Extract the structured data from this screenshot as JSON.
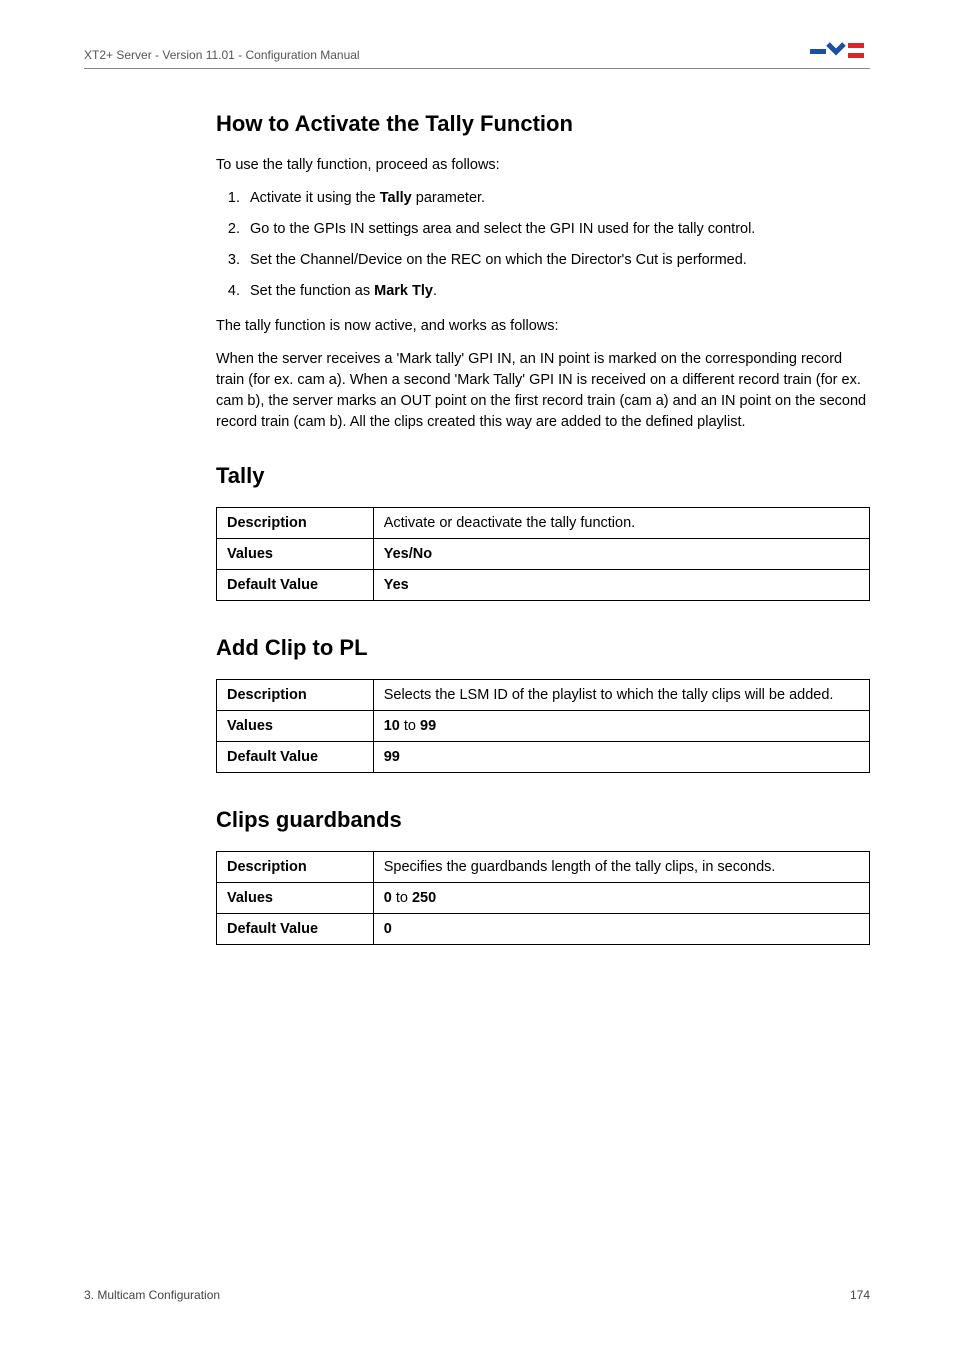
{
  "header": {
    "doc_title": "XT2+ Server - Version 11.01 - Configuration Manual"
  },
  "sections": {
    "activate": {
      "title": "How to Activate the Tally Function",
      "intro": "To use the tally function, proceed as follows:",
      "step1_pre": "Activate it using the ",
      "step1_bold": "Tally",
      "step1_post": " parameter.",
      "step2": "Go to the GPIs IN settings area and select the GPI IN used for the tally control.",
      "step3": "Set the Channel/Device on the REC on which the Director's Cut is performed.",
      "step4_pre": "Set the function as ",
      "step4_bold": "Mark Tly",
      "step4_post": ".",
      "after_steps": "The tally function is now active, and works as follows:",
      "explain": "When the server receives a 'Mark tally' GPI IN, an IN point is marked on the corresponding record train (for ex. cam a). When a second 'Mark Tally' GPI IN is received on a different record train (for ex. cam b), the server marks an OUT point on the first record train (cam a) and an IN point on the second record train (cam b). All the clips created this way are added to the defined playlist."
    },
    "tally": {
      "title": "Tally",
      "desc_label": "Description",
      "desc_value": "Activate or deactivate the tally function.",
      "values_label": "Values",
      "values_value": "Yes/No",
      "default_label": "Default Value",
      "default_value": "Yes"
    },
    "addclip": {
      "title": "Add Clip to PL",
      "desc_label": "Description",
      "desc_value": "Selects the LSM ID of the playlist to which the tally clips will be added.",
      "values_label": "Values",
      "values_value_a": "10",
      "values_value_mid": " to ",
      "values_value_b": "99",
      "default_label": "Default Value",
      "default_value": "99"
    },
    "guardbands": {
      "title": "Clips guardbands",
      "desc_label": "Description",
      "desc_value": "Specifies the guardbands length of the tally clips, in seconds.",
      "values_label": "Values",
      "values_value_a": "0",
      "values_value_mid": " to ",
      "values_value_b": "250",
      "default_label": "Default Value",
      "default_value": "0"
    }
  },
  "footer": {
    "left": "3. Multicam Configuration",
    "right": "174"
  }
}
